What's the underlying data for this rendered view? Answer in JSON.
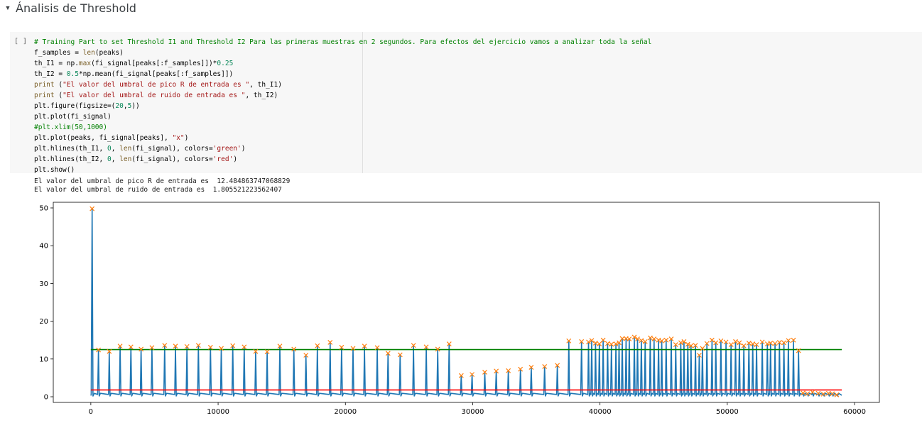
{
  "section": {
    "title": "Ánalisis de Threshold",
    "caret_icon": "triangle-down-icon"
  },
  "cell": {
    "run_indicator": "[ ]",
    "code_lines": [
      [
        {
          "t": "comment",
          "v": "# Training Part to set Threshold I1 and Threshold I2 Para las primeras muestras en 2 segundos. Para efectos del ejercicio vamos a analizar toda la señal"
        }
      ],
      [
        {
          "t": "plain",
          "v": "f_samples = "
        },
        {
          "t": "func",
          "v": "len"
        },
        {
          "t": "plain",
          "v": "(peaks)"
        }
      ],
      [
        {
          "t": "plain",
          "v": "th_I1 = np."
        },
        {
          "t": "func",
          "v": "max"
        },
        {
          "t": "plain",
          "v": "(fi_signal[peaks[:f_samples]])*"
        },
        {
          "t": "number",
          "v": "0.25"
        }
      ],
      [
        {
          "t": "plain",
          "v": "th_I2 = "
        },
        {
          "t": "number",
          "v": "0.5"
        },
        {
          "t": "plain",
          "v": "*np.mean(fi_signal[peaks[:f_samples]])"
        }
      ],
      [
        {
          "t": "func",
          "v": "print"
        },
        {
          "t": "plain",
          "v": " ("
        },
        {
          "t": "string",
          "v": "\"El valor del umbral de pico R de entrada es \""
        },
        {
          "t": "plain",
          "v": ", th_I1)"
        }
      ],
      [
        {
          "t": "func",
          "v": "print"
        },
        {
          "t": "plain",
          "v": " ("
        },
        {
          "t": "string",
          "v": "\"El valor del umbral de ruido de entrada es \""
        },
        {
          "t": "plain",
          "v": ", th_I2)"
        }
      ],
      [
        {
          "t": "plain",
          "v": "plt.figure(figsize=("
        },
        {
          "t": "number",
          "v": "20"
        },
        {
          "t": "plain",
          "v": ","
        },
        {
          "t": "number",
          "v": "5"
        },
        {
          "t": "plain",
          "v": "))"
        }
      ],
      [
        {
          "t": "plain",
          "v": "plt.plot(fi_signal)"
        }
      ],
      [
        {
          "t": "comment",
          "v": "#plt.xlim(50,1000)"
        }
      ],
      [
        {
          "t": "plain",
          "v": "plt.plot(peaks, fi_signal[peaks], "
        },
        {
          "t": "string",
          "v": "\"x\""
        },
        {
          "t": "plain",
          "v": ")"
        }
      ],
      [
        {
          "t": "plain",
          "v": "plt.hlines(th_I1, "
        },
        {
          "t": "number",
          "v": "0"
        },
        {
          "t": "plain",
          "v": ", "
        },
        {
          "t": "func",
          "v": "len"
        },
        {
          "t": "plain",
          "v": "(fi_signal), colors="
        },
        {
          "t": "string",
          "v": "'green'"
        },
        {
          "t": "plain",
          "v": ")"
        }
      ],
      [
        {
          "t": "plain",
          "v": "plt.hlines(th_I2, "
        },
        {
          "t": "number",
          "v": "0"
        },
        {
          "t": "plain",
          "v": ", "
        },
        {
          "t": "func",
          "v": "len"
        },
        {
          "t": "plain",
          "v": "(fi_signal), colors="
        },
        {
          "t": "string",
          "v": "'red'"
        },
        {
          "t": "plain",
          "v": ")"
        }
      ],
      [
        {
          "t": "plain",
          "v": "plt.show()"
        }
      ]
    ],
    "output_lines": [
      "El valor del umbral de pico R de entrada es  12.484863747068829",
      "El valor del umbral de ruido de entrada es  1.805521223562407"
    ]
  },
  "colors": {
    "signal": "#1f77b4",
    "peaks": "#ff7f0e",
    "threshold_I1": "#008000",
    "threshold_I2": "#ff0000",
    "code_comment": "#008000",
    "code_string": "#a31515",
    "code_number": "#098658"
  },
  "chart_data": {
    "type": "line",
    "xlim": [
      -2950,
      61950
    ],
    "ylim": [
      -1.5,
      51.5
    ],
    "x_ticks": [
      0,
      10000,
      20000,
      30000,
      40000,
      50000,
      60000
    ],
    "x_tick_labels": [
      "0",
      "10000",
      "20000",
      "30000",
      "40000",
      "50000",
      "60000"
    ],
    "y_ticks": [
      0,
      10,
      20,
      30,
      40,
      50
    ],
    "y_tick_labels": [
      "0",
      "10",
      "20",
      "30",
      "40",
      "50"
    ],
    "grid": false,
    "thresholds": [
      {
        "value": 12.484863747068829,
        "xmin": 0,
        "xmax": 59000,
        "color": "green"
      },
      {
        "value": 1.805521223562407,
        "xmin": 0,
        "xmax": 59000,
        "color": "red"
      }
    ],
    "peaks": {
      "x": [
        100,
        600,
        1450,
        2300,
        3150,
        3950,
        4800,
        5800,
        6650,
        7550,
        8450,
        9400,
        10250,
        11150,
        12050,
        12950,
        13850,
        14850,
        15950,
        16900,
        17800,
        18800,
        19700,
        20600,
        21500,
        22500,
        23350,
        24300,
        25350,
        26350,
        27250,
        28150,
        29100,
        29950,
        30950,
        31850,
        32800,
        33750,
        34600,
        35650,
        36650,
        37550,
        38550,
        39100,
        39350,
        39650,
        39950,
        40250,
        40600,
        40900,
        41250,
        41500,
        41750,
        42050,
        42300,
        42700,
        42950,
        43250,
        43550,
        43950,
        44250,
        44600,
        44850,
        45200,
        45600,
        45950,
        46350,
        46600,
        46900,
        47150,
        47500,
        47800,
        48050,
        48400,
        48800,
        49100,
        49500,
        49900,
        50300,
        50650,
        50950,
        51300,
        51700,
        52000,
        52300,
        52750,
        53150,
        53400,
        53750,
        54100,
        54450,
        54800,
        55200,
        55600,
        55950,
        56300,
        56700,
        57150,
        57550,
        57950,
        58250,
        58600
      ],
      "y": [
        49.8,
        12.4,
        12.0,
        13.4,
        13.2,
        12.6,
        13.0,
        13.6,
        13.4,
        13.3,
        13.6,
        13.1,
        12.8,
        13.5,
        13.2,
        12.0,
        11.9,
        13.4,
        12.6,
        11.0,
        13.5,
        14.4,
        13.1,
        12.8,
        13.4,
        13.0,
        11.5,
        11.1,
        13.6,
        13.2,
        12.6,
        14.0,
        5.6,
        5.9,
        6.5,
        6.8,
        6.9,
        7.3,
        7.8,
        8.0,
        8.3,
        14.8,
        14.6,
        14.5,
        14.9,
        14.2,
        14.0,
        15.0,
        14.1,
        13.9,
        14.0,
        14.3,
        15.4,
        15.4,
        15.3,
        15.8,
        15.3,
        14.9,
        14.6,
        15.6,
        15.3,
        15.0,
        14.8,
        15.0,
        15.3,
        13.8,
        14.3,
        14.6,
        13.9,
        13.5,
        13.6,
        11.0,
        12.8,
        14.1,
        15.0,
        14.3,
        14.8,
        14.5,
        13.8,
        14.6,
        14.3,
        13.5,
        14.2,
        14.0,
        13.8,
        14.5,
        14.0,
        14.2,
        14.1,
        14.4,
        14.3,
        14.9,
        15.0,
        12.2,
        1.0,
        0.8,
        1.2,
        0.9,
        0.7,
        0.9,
        0.8,
        0.5
      ]
    }
  }
}
